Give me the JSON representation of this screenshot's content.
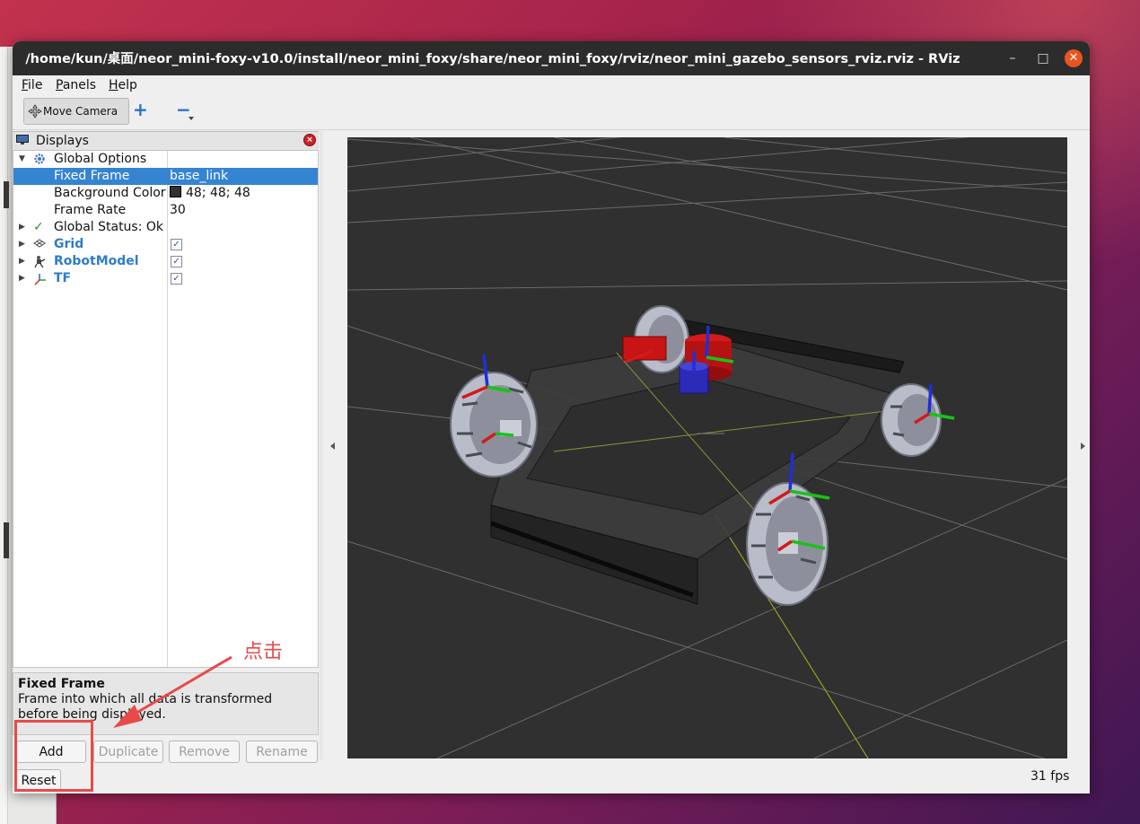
{
  "window": {
    "title": "/home/kun/桌面/neor_mini-foxy-v10.0/install/neor_mini_foxy/share/neor_mini_foxy/rviz/neor_mini_gazebo_sensors_rviz.rviz - RViz",
    "minimize_glyph": "–",
    "maximize_glyph": "□",
    "close_glyph": "✕"
  },
  "menu": {
    "file": {
      "accel": "F",
      "rest": "ile"
    },
    "panels": {
      "accel": "P",
      "rest": "anels"
    },
    "help": {
      "accel": "H",
      "rest": "elp"
    }
  },
  "toolbar": {
    "move_camera": "Move Camera",
    "add_tool": "+",
    "remove_tool": "−"
  },
  "displays": {
    "title": "Displays",
    "close_glyph": "×",
    "tree": [
      {
        "name": "Global Options",
        "value": "",
        "expanded": true,
        "icon": "gear-icon"
      },
      {
        "name": "Fixed Frame",
        "value": "base_link",
        "selected": true
      },
      {
        "name": "Background Color",
        "value": "48; 48; 48",
        "swatch": "#303030"
      },
      {
        "name": "Frame Rate",
        "value": "30"
      },
      {
        "name": "Global Status: Ok",
        "value": "",
        "icon": "checkmark-icon"
      },
      {
        "name": "Grid",
        "checked": true,
        "icon": "grid-icon"
      },
      {
        "name": "RobotModel",
        "checked": true,
        "icon": "robot-icon"
      },
      {
        "name": "TF",
        "checked": true,
        "icon": "axes-icon"
      }
    ],
    "check_glyph": "✓",
    "arrow_down": "▼",
    "arrow_right": "▶"
  },
  "description": {
    "title": "Fixed Frame",
    "text": "Frame into which all data is transformed before being displayed."
  },
  "buttons": {
    "add": "Add",
    "duplicate": "Duplicate",
    "remove": "Remove",
    "rename": "Rename",
    "reset": "Reset"
  },
  "status": {
    "fps": "31 fps"
  },
  "annotation": {
    "label": "点击",
    "color": "#e84a4a"
  },
  "colors": {
    "viewport_bg": "#303030",
    "selection": "#3584d1",
    "accent": "#e95420"
  }
}
